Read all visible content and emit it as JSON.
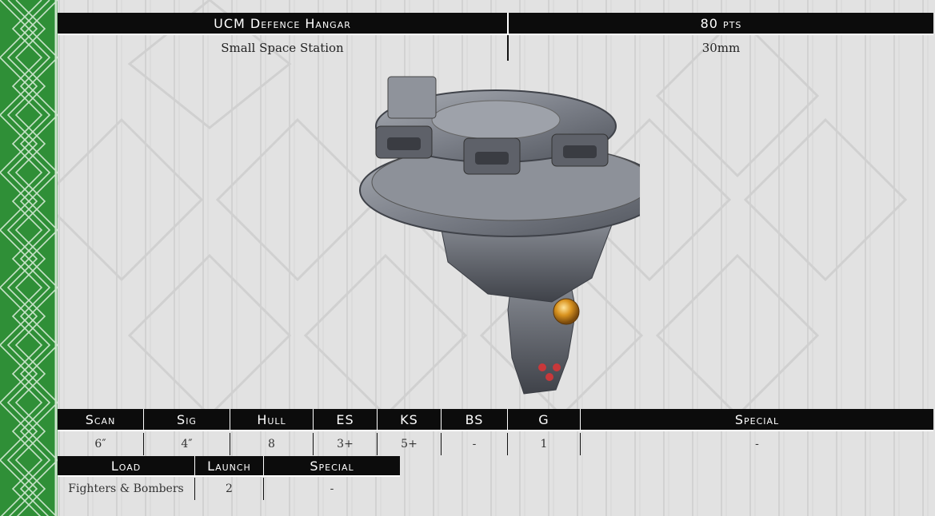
{
  "header": {
    "name": "UCM Defence Hangar",
    "points": "80 pts"
  },
  "subheader": {
    "type": "Small Space Station",
    "base": "30mm"
  },
  "stats": {
    "headers": [
      "Scan",
      "Sig",
      "Hull",
      "ES",
      "KS",
      "BS",
      "G",
      "Special"
    ],
    "values": [
      "6″",
      "4″",
      "8",
      "3+",
      "5+",
      "-",
      "1",
      "-"
    ]
  },
  "launch": {
    "headers": [
      "Load",
      "Launch",
      "Special"
    ],
    "values": [
      "Fighters & Bombers",
      "2",
      "-"
    ]
  },
  "image": {
    "subject": "space-station-miniature-image"
  },
  "colors": {
    "accent_green": "#2f8f37",
    "header_black": "#0c0c0c"
  }
}
